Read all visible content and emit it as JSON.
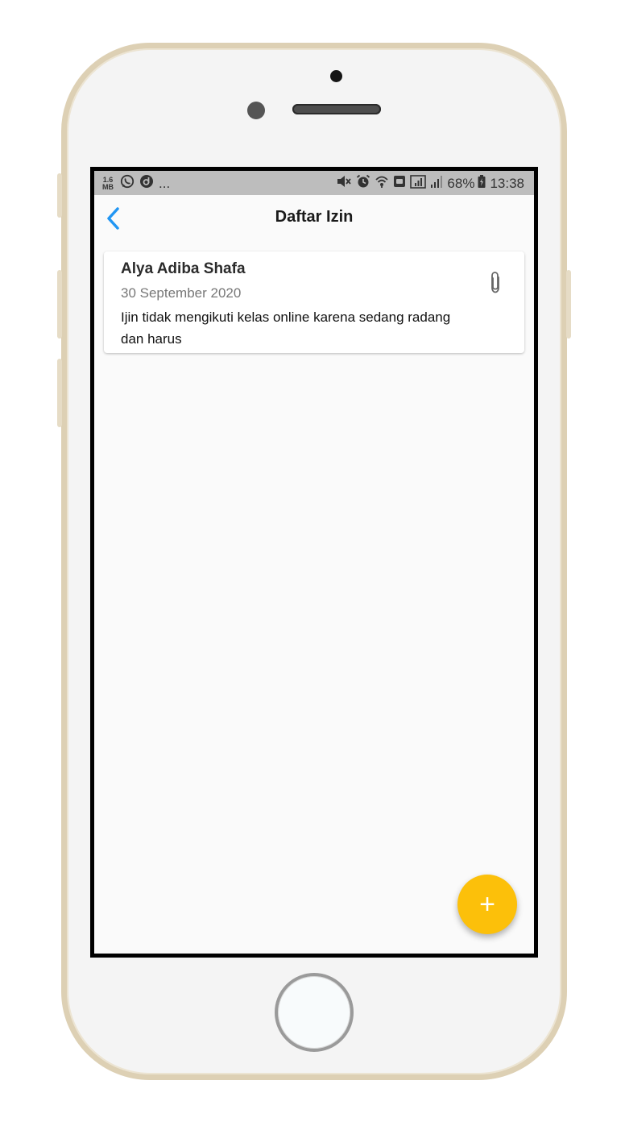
{
  "statusbar": {
    "netspeed_value": "1.6",
    "netspeed_unit": "MB",
    "more_indicator": "...",
    "battery_percent": "68%",
    "time": "13:38",
    "left_icons": [
      "whatsapp-icon",
      "notification-app-icon"
    ],
    "right_icons": [
      "mute-icon",
      "alarm-icon",
      "wifi-icon",
      "sd-card-icon",
      "signal-box-icon",
      "signal-bars-icon",
      "battery-icon"
    ]
  },
  "appbar": {
    "title": "Daftar Izin",
    "back_icon": "chevron-left-icon"
  },
  "permits": [
    {
      "name": "Alya Adiba Shafa",
      "date": "30 September 2020",
      "description": "Ijin tidak mengikuti kelas online karena sedang radang dan harus",
      "attachment_icon": "paperclip-icon"
    }
  ],
  "fab": {
    "label": "+"
  },
  "colors": {
    "accent": "#2196f3",
    "fab": "#fcc00a",
    "statusbar": "#bdbdbd",
    "phone_frame": "#ddd0b4"
  }
}
